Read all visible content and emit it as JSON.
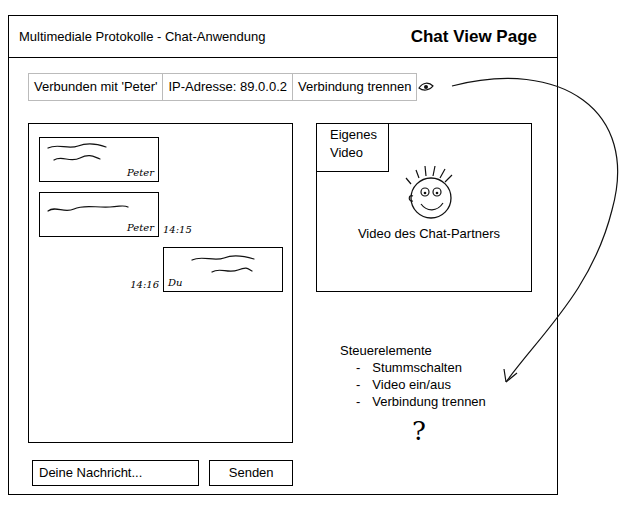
{
  "window": {
    "title": "Multimediale Protokolle - Chat-Anwendung",
    "page_label": "Chat View Page"
  },
  "connection_bar": [
    "Verbunden mit 'Peter'",
    "IP-Adresse: 89.0.0.2",
    "Verbindung trennen"
  ],
  "messages": [
    {
      "sender": "Peter",
      "own": false
    },
    {
      "sender": "Peter",
      "time": "14:15",
      "own": false
    },
    {
      "sender": "Du",
      "time": "14:16",
      "own": true
    }
  ],
  "video": {
    "own_label": "Eigenes Video",
    "partner_label": "Video des Chat-Partners"
  },
  "controls": {
    "title": "Steuerelemente",
    "bullet": "-",
    "items": [
      "Stummschalten",
      "Video ein/aus",
      "Verbindung trennen"
    ],
    "note": "?"
  },
  "input": {
    "placeholder": "Deine Nachricht...",
    "button": "Senden"
  }
}
